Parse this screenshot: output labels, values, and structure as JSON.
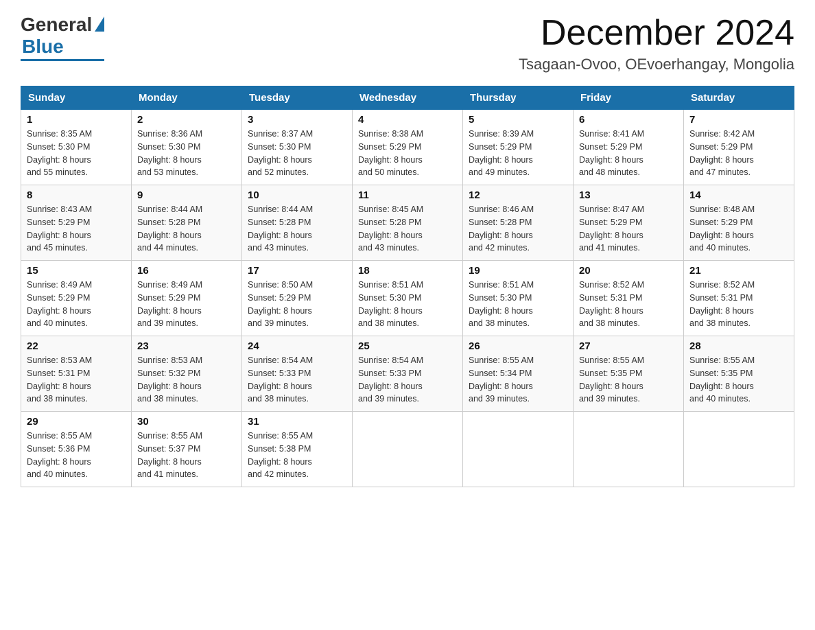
{
  "logo": {
    "general": "General",
    "blue": "Blue"
  },
  "title": "December 2024",
  "location": "Tsagaan-Ovoo, OEvoerhangay, Mongolia",
  "days_of_week": [
    "Sunday",
    "Monday",
    "Tuesday",
    "Wednesday",
    "Thursday",
    "Friday",
    "Saturday"
  ],
  "weeks": [
    [
      {
        "day": "1",
        "sunrise": "8:35 AM",
        "sunset": "5:30 PM",
        "daylight": "8 hours and 55 minutes."
      },
      {
        "day": "2",
        "sunrise": "8:36 AM",
        "sunset": "5:30 PM",
        "daylight": "8 hours and 53 minutes."
      },
      {
        "day": "3",
        "sunrise": "8:37 AM",
        "sunset": "5:30 PM",
        "daylight": "8 hours and 52 minutes."
      },
      {
        "day": "4",
        "sunrise": "8:38 AM",
        "sunset": "5:29 PM",
        "daylight": "8 hours and 50 minutes."
      },
      {
        "day": "5",
        "sunrise": "8:39 AM",
        "sunset": "5:29 PM",
        "daylight": "8 hours and 49 minutes."
      },
      {
        "day": "6",
        "sunrise": "8:41 AM",
        "sunset": "5:29 PM",
        "daylight": "8 hours and 48 minutes."
      },
      {
        "day": "7",
        "sunrise": "8:42 AM",
        "sunset": "5:29 PM",
        "daylight": "8 hours and 47 minutes."
      }
    ],
    [
      {
        "day": "8",
        "sunrise": "8:43 AM",
        "sunset": "5:29 PM",
        "daylight": "8 hours and 45 minutes."
      },
      {
        "day": "9",
        "sunrise": "8:44 AM",
        "sunset": "5:28 PM",
        "daylight": "8 hours and 44 minutes."
      },
      {
        "day": "10",
        "sunrise": "8:44 AM",
        "sunset": "5:28 PM",
        "daylight": "8 hours and 43 minutes."
      },
      {
        "day": "11",
        "sunrise": "8:45 AM",
        "sunset": "5:28 PM",
        "daylight": "8 hours and 43 minutes."
      },
      {
        "day": "12",
        "sunrise": "8:46 AM",
        "sunset": "5:28 PM",
        "daylight": "8 hours and 42 minutes."
      },
      {
        "day": "13",
        "sunrise": "8:47 AM",
        "sunset": "5:29 PM",
        "daylight": "8 hours and 41 minutes."
      },
      {
        "day": "14",
        "sunrise": "8:48 AM",
        "sunset": "5:29 PM",
        "daylight": "8 hours and 40 minutes."
      }
    ],
    [
      {
        "day": "15",
        "sunrise": "8:49 AM",
        "sunset": "5:29 PM",
        "daylight": "8 hours and 40 minutes."
      },
      {
        "day": "16",
        "sunrise": "8:49 AM",
        "sunset": "5:29 PM",
        "daylight": "8 hours and 39 minutes."
      },
      {
        "day": "17",
        "sunrise": "8:50 AM",
        "sunset": "5:29 PM",
        "daylight": "8 hours and 39 minutes."
      },
      {
        "day": "18",
        "sunrise": "8:51 AM",
        "sunset": "5:30 PM",
        "daylight": "8 hours and 38 minutes."
      },
      {
        "day": "19",
        "sunrise": "8:51 AM",
        "sunset": "5:30 PM",
        "daylight": "8 hours and 38 minutes."
      },
      {
        "day": "20",
        "sunrise": "8:52 AM",
        "sunset": "5:31 PM",
        "daylight": "8 hours and 38 minutes."
      },
      {
        "day": "21",
        "sunrise": "8:52 AM",
        "sunset": "5:31 PM",
        "daylight": "8 hours and 38 minutes."
      }
    ],
    [
      {
        "day": "22",
        "sunrise": "8:53 AM",
        "sunset": "5:31 PM",
        "daylight": "8 hours and 38 minutes."
      },
      {
        "day": "23",
        "sunrise": "8:53 AM",
        "sunset": "5:32 PM",
        "daylight": "8 hours and 38 minutes."
      },
      {
        "day": "24",
        "sunrise": "8:54 AM",
        "sunset": "5:33 PM",
        "daylight": "8 hours and 38 minutes."
      },
      {
        "day": "25",
        "sunrise": "8:54 AM",
        "sunset": "5:33 PM",
        "daylight": "8 hours and 39 minutes."
      },
      {
        "day": "26",
        "sunrise": "8:55 AM",
        "sunset": "5:34 PM",
        "daylight": "8 hours and 39 minutes."
      },
      {
        "day": "27",
        "sunrise": "8:55 AM",
        "sunset": "5:35 PM",
        "daylight": "8 hours and 39 minutes."
      },
      {
        "day": "28",
        "sunrise": "8:55 AM",
        "sunset": "5:35 PM",
        "daylight": "8 hours and 40 minutes."
      }
    ],
    [
      {
        "day": "29",
        "sunrise": "8:55 AM",
        "sunset": "5:36 PM",
        "daylight": "8 hours and 40 minutes."
      },
      {
        "day": "30",
        "sunrise": "8:55 AM",
        "sunset": "5:37 PM",
        "daylight": "8 hours and 41 minutes."
      },
      {
        "day": "31",
        "sunrise": "8:55 AM",
        "sunset": "5:38 PM",
        "daylight": "8 hours and 42 minutes."
      },
      null,
      null,
      null,
      null
    ]
  ],
  "labels": {
    "sunrise": "Sunrise:",
    "sunset": "Sunset:",
    "daylight": "Daylight:"
  },
  "accent_color": "#1a6fa8"
}
